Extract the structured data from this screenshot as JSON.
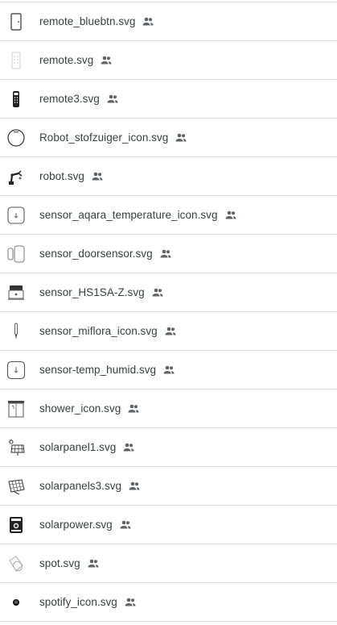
{
  "files": [
    {
      "name": "remote_bluebtn.svg",
      "icon": "remote-door-icon",
      "shared": true
    },
    {
      "name": "remote.svg",
      "icon": "remote-light-icon",
      "shared": true
    },
    {
      "name": "remote3.svg",
      "icon": "remote-dark-icon",
      "shared": true
    },
    {
      "name": "Robot_stofzuiger_icon.svg",
      "icon": "robot-vacuum-icon",
      "shared": true
    },
    {
      "name": "robot.svg",
      "icon": "robot-arm-icon",
      "shared": true
    },
    {
      "name": "sensor_aqara_temperature_icon.svg",
      "icon": "temperature-sensor-icon",
      "shared": true
    },
    {
      "name": "sensor_doorsensor.svg",
      "icon": "door-sensor-icon",
      "shared": true
    },
    {
      "name": "sensor_HS1SA-Z.svg",
      "icon": "smoke-sensor-icon",
      "shared": true
    },
    {
      "name": "sensor_miflora_icon.svg",
      "icon": "plant-sensor-icon",
      "shared": true
    },
    {
      "name": "sensor-temp_humid.svg",
      "icon": "temp-humid-sensor-icon",
      "shared": true
    },
    {
      "name": "shower_icon.svg",
      "icon": "shower-icon",
      "shared": true
    },
    {
      "name": "solarpanel1.svg",
      "icon": "solar-panel-icon",
      "shared": true
    },
    {
      "name": "solarpanels3.svg",
      "icon": "solar-panels-icon",
      "shared": true
    },
    {
      "name": "solarpower.svg",
      "icon": "solar-power-icon",
      "shared": true
    },
    {
      "name": "spot.svg",
      "icon": "spotlight-icon",
      "shared": true
    },
    {
      "name": "spotify_icon.svg",
      "icon": "spotify-icon",
      "shared": true
    }
  ],
  "shared_icon": "people-icon",
  "colors": {
    "text": "#3c4043",
    "divider": "#dadce0",
    "shared_icon": "#5f6368"
  }
}
